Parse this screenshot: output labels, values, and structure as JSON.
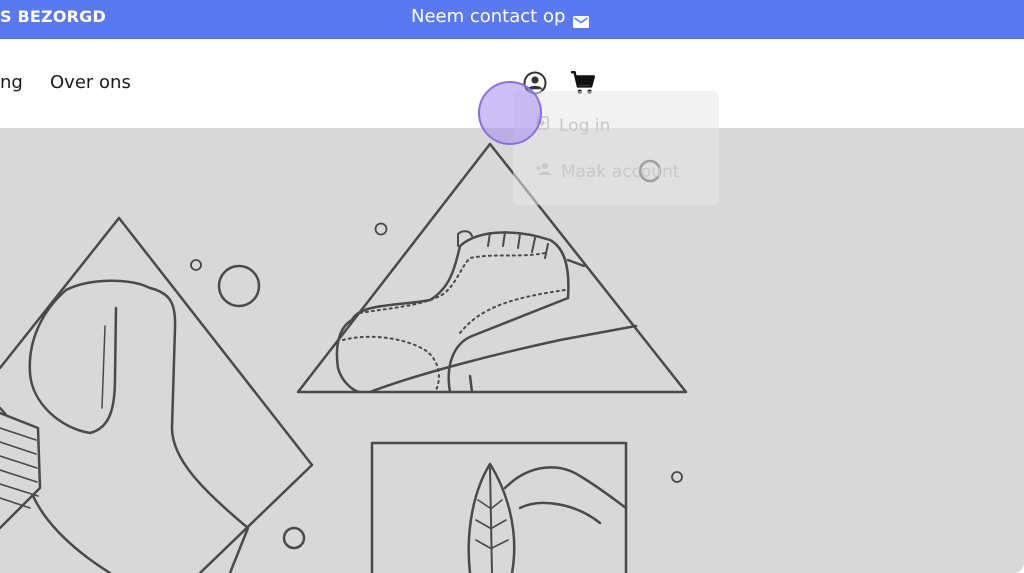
{
  "topbar": {
    "brand": "S BEZORGD",
    "contact_label": "Neem contact op",
    "contact_icon": "mail-icon",
    "bg_color": "#5a78f0"
  },
  "navbar": {
    "items": [
      {
        "label": "ng"
      },
      {
        "label": "Over ons"
      }
    ],
    "account_icon": "account-circle-icon",
    "cart_icon": "shopping-cart-icon"
  },
  "account_menu": {
    "items": [
      {
        "label": "Log in",
        "icon": "login-icon"
      },
      {
        "label": "Maak account",
        "icon": "add-user-icon"
      }
    ]
  },
  "hero": {
    "bg_color": "#d8d8d8",
    "illustration": "shoe-line-art"
  }
}
